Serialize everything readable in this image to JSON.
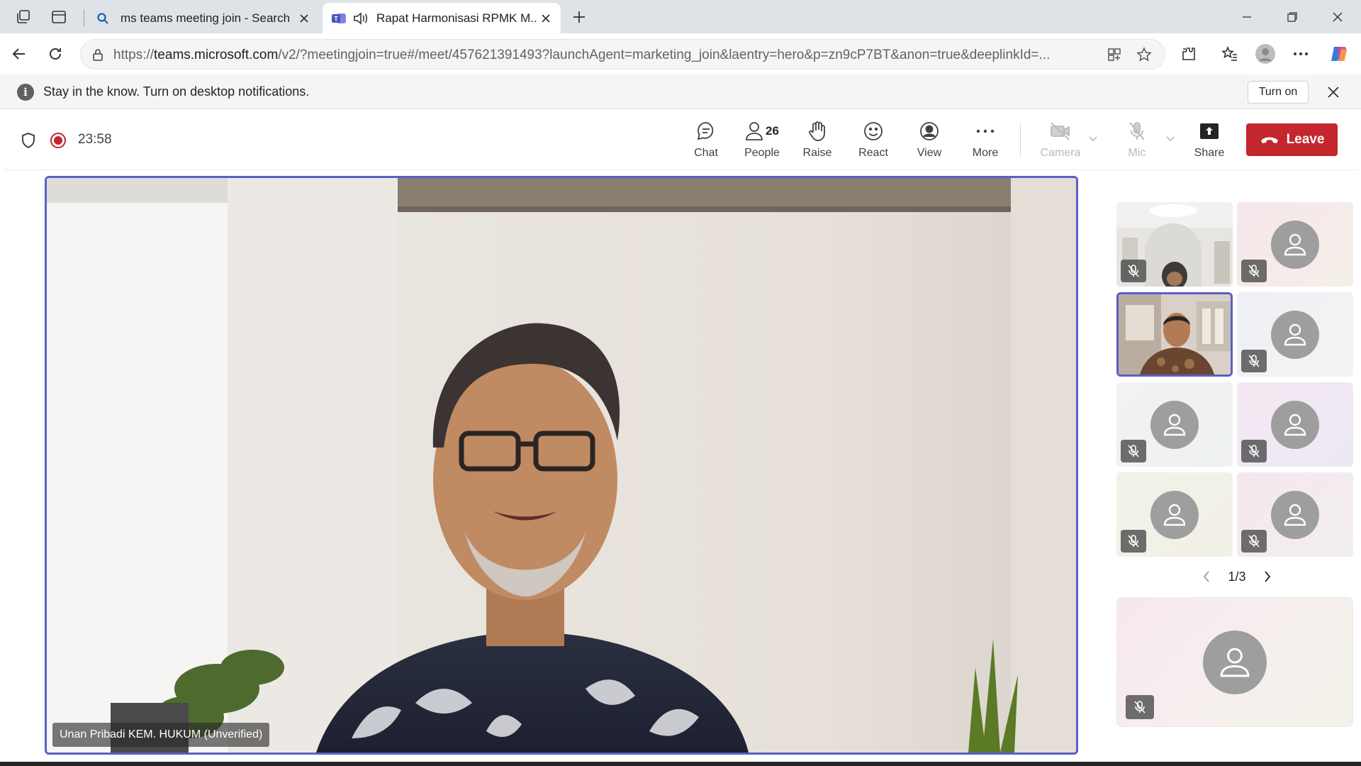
{
  "browser": {
    "tabs": [
      {
        "title": "ms teams meeting join - Search",
        "favicon": "search-icon",
        "active": false
      },
      {
        "title": "Rapat Harmonisasi RPMK M...",
        "favicon": "teams-icon",
        "audio": "speaker-icon",
        "active": true
      }
    ],
    "url_prefix": "https://",
    "url_host": "teams.microsoft.com",
    "url_path": "/v2/?meetingjoin=true#/meet/457621391493?launchAgent=marketing_join&laentry=hero&p=zn9cP7BT&anon=true&deeplinkId=..."
  },
  "notification": {
    "message": "Stay in the know. Turn on desktop notifications.",
    "button": "Turn on"
  },
  "meeting": {
    "timer": "23:58",
    "toolbar": {
      "chat": "Chat",
      "people": "People",
      "people_count": "26",
      "raise": "Raise",
      "react": "React",
      "view": "View",
      "more": "More",
      "camera": "Camera",
      "mic": "Mic",
      "share": "Share",
      "leave": "Leave"
    },
    "main_speaker": "Unan Pribadi KEM. HUKUM (Unverified)",
    "pager": "1/3"
  },
  "colors": {
    "accent": "#5b5fc7",
    "leave": "#c4262e",
    "recording": "#c4262e"
  }
}
